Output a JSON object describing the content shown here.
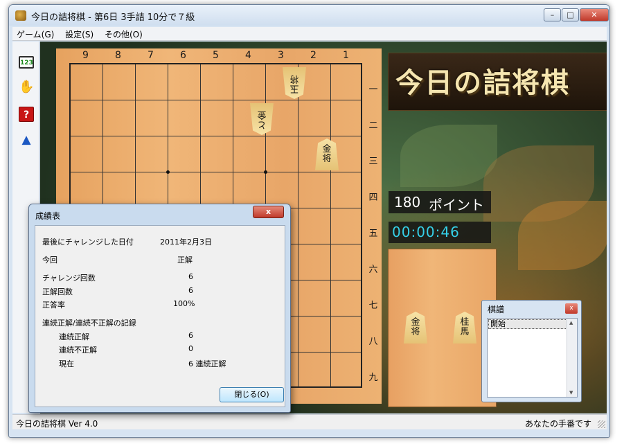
{
  "window": {
    "title": "今日の詰将棋 - 第6日  3手詰  10分で７級",
    "minimize_icon": "minimize-icon",
    "maximize_icon": "maximize-icon",
    "close_icon": "close-icon"
  },
  "menu": {
    "items": [
      "ゲーム(G)",
      "設定(S)",
      "その他(O)"
    ]
  },
  "toolbar": {
    "tools": [
      {
        "name": "record-123-icon",
        "label": "123"
      },
      {
        "name": "hand-icon",
        "label": "✋"
      },
      {
        "name": "help-icon",
        "label": "?"
      },
      {
        "name": "hint-icon",
        "label": "?"
      }
    ]
  },
  "board": {
    "files": [
      "9",
      "8",
      "7",
      "6",
      "5",
      "4",
      "3",
      "2",
      "1"
    ],
    "ranks": [
      "一",
      "二",
      "三",
      "四",
      "五",
      "六",
      "七",
      "八",
      "九"
    ],
    "pieces": [
      {
        "line1": "玉",
        "line2": "将",
        "inverted": true
      },
      {
        "line1": "と",
        "line2": "金",
        "inverted": true
      },
      {
        "line1": "金",
        "line2": "将",
        "inverted": false
      }
    ]
  },
  "logo": {
    "text": "今日の詰将棋"
  },
  "score": {
    "points": "180",
    "unit": "ポイント"
  },
  "timer": {
    "value": "00:00:46"
  },
  "hand": {
    "pieces": [
      {
        "line1": "金",
        "line2": "将"
      },
      {
        "line1": "桂",
        "line2": "馬"
      }
    ]
  },
  "kifu": {
    "title": "棋譜",
    "close_label": "x",
    "items": [
      "開始"
    ]
  },
  "status": {
    "left": "今日の詰将棋 Ver 4.0",
    "right": "あなたの手番です"
  },
  "dialog": {
    "title": "成績表",
    "close_label": "x",
    "last_challenge_label": "最後にチャレンジした日付",
    "last_challenge_value": "2011年2月3日",
    "this_time_label": "今回",
    "this_time_value": "正解",
    "challenges_label": "チャレンジ回数",
    "challenges_value": "6",
    "correct_label": "正解回数",
    "correct_value": "6",
    "rate_label": "正答率",
    "rate_value": "100%",
    "streak_header": "連続正解/連続不正解の記録",
    "streak_correct_label": "連続正解",
    "streak_correct_value": "6",
    "streak_wrong_label": "連続不正解",
    "streak_wrong_value": "0",
    "current_label": "現在",
    "current_value": "6 連続正解",
    "ok_button": "閉じる(O)"
  }
}
